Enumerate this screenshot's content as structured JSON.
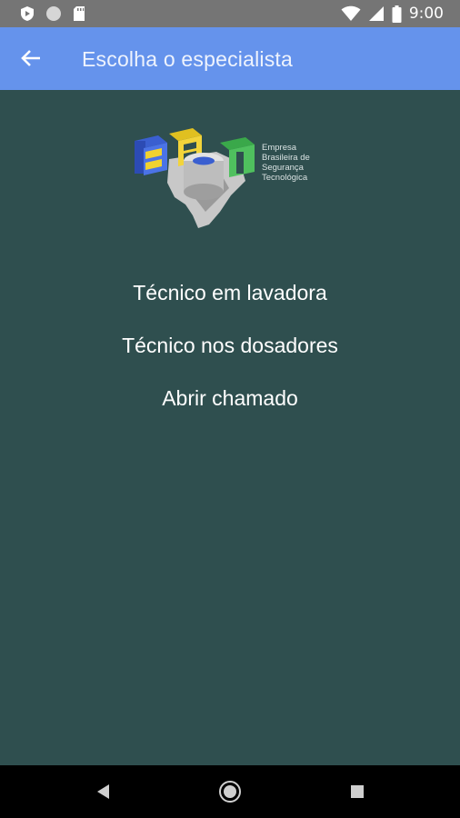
{
  "status_bar": {
    "time": "9:00",
    "icons_left": [
      "shield-app-icon",
      "circle-app-icon",
      "sd-card-icon"
    ],
    "icons_right": [
      "wifi-icon",
      "signal-icon",
      "battery-icon"
    ]
  },
  "app_bar": {
    "back_icon": "arrow-back-icon",
    "title": "Escolha o especialista"
  },
  "logo": {
    "lines": [
      "Empresa",
      "Brasileira de",
      "Segurança",
      "Tecnológica"
    ]
  },
  "menu": {
    "items": [
      {
        "label": "Técnico em lavadora"
      },
      {
        "label": "Técnico nos dosadores"
      },
      {
        "label": "Abrir chamado"
      }
    ]
  },
  "nav_bar": {
    "buttons": [
      "back-triangle-icon",
      "home-circle-icon",
      "recents-square-icon"
    ]
  },
  "colors": {
    "background": "#2f4f4f",
    "app_bar": "#6593ec",
    "status_bar": "#757575",
    "text": "#ffffff"
  }
}
